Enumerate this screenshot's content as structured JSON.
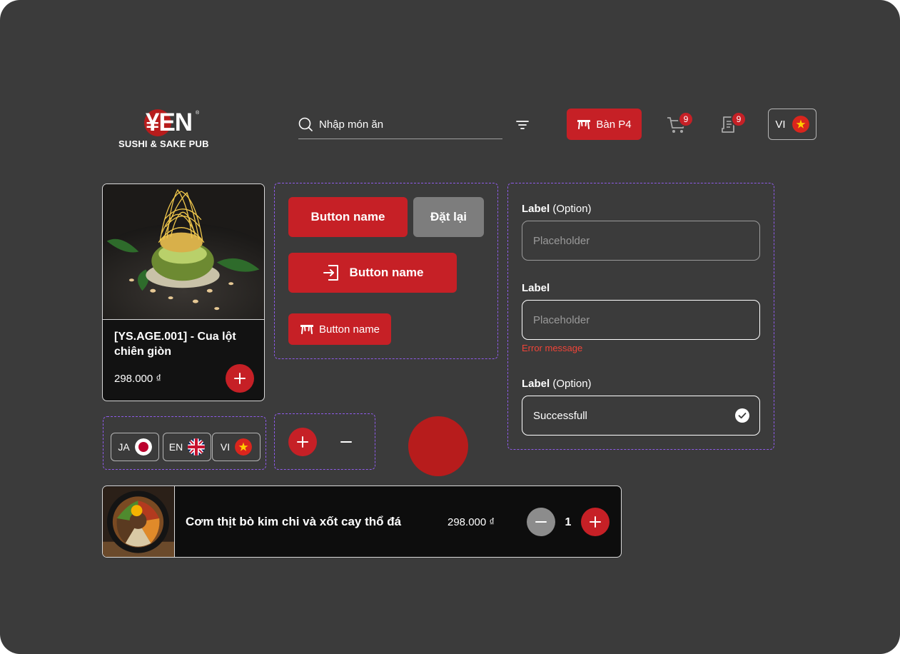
{
  "colors": {
    "background": "#3b3b3b",
    "primary_red": "#c62026",
    "reset_gray": "#7d7d7d",
    "error_red": "#f04438",
    "dashed_border": "#8f5bea"
  },
  "header": {
    "logo_text": "¥EN",
    "logo_registered": "®",
    "logo_subtitle": "SUSHI & SAKE PUB",
    "search_placeholder": "Nhập món ăn",
    "table_button_label": "Bàn P4",
    "cart_badge": "9",
    "orders_badge": "9",
    "language_code": "VI",
    "icons": [
      "search-icon",
      "filter-icon",
      "table-icon",
      "cart-icon",
      "orders-icon",
      "vietnam-flag-icon"
    ]
  },
  "product_card": {
    "title": "[YS.AGE.001] - Cua lột chiên giòn",
    "price": "298.000 ₫"
  },
  "buttons": {
    "primary_label": "Button name",
    "reset_label": "Đặt lại",
    "icon_button_label": "Button name",
    "small_button_label": "Button name"
  },
  "form": {
    "field1": {
      "label": "Label",
      "label_suffix": "(Option)",
      "placeholder": "Placeholder"
    },
    "field2": {
      "label": "Label",
      "placeholder": "Placeholder",
      "error": "Error message"
    },
    "field3": {
      "label": "Label",
      "label_suffix": "(Option)",
      "value": "Successfull"
    }
  },
  "language_chips": [
    {
      "code": "JA",
      "flag": "japan-flag-icon"
    },
    {
      "code": "EN",
      "flag": "uk-flag-icon"
    },
    {
      "code": "VI",
      "flag": "vietnam-flag-icon"
    }
  ],
  "cart_item": {
    "name": "Cơm thịt bò kim chi và xốt cay thổ đá",
    "price": "298.000 ₫",
    "quantity": "1"
  }
}
